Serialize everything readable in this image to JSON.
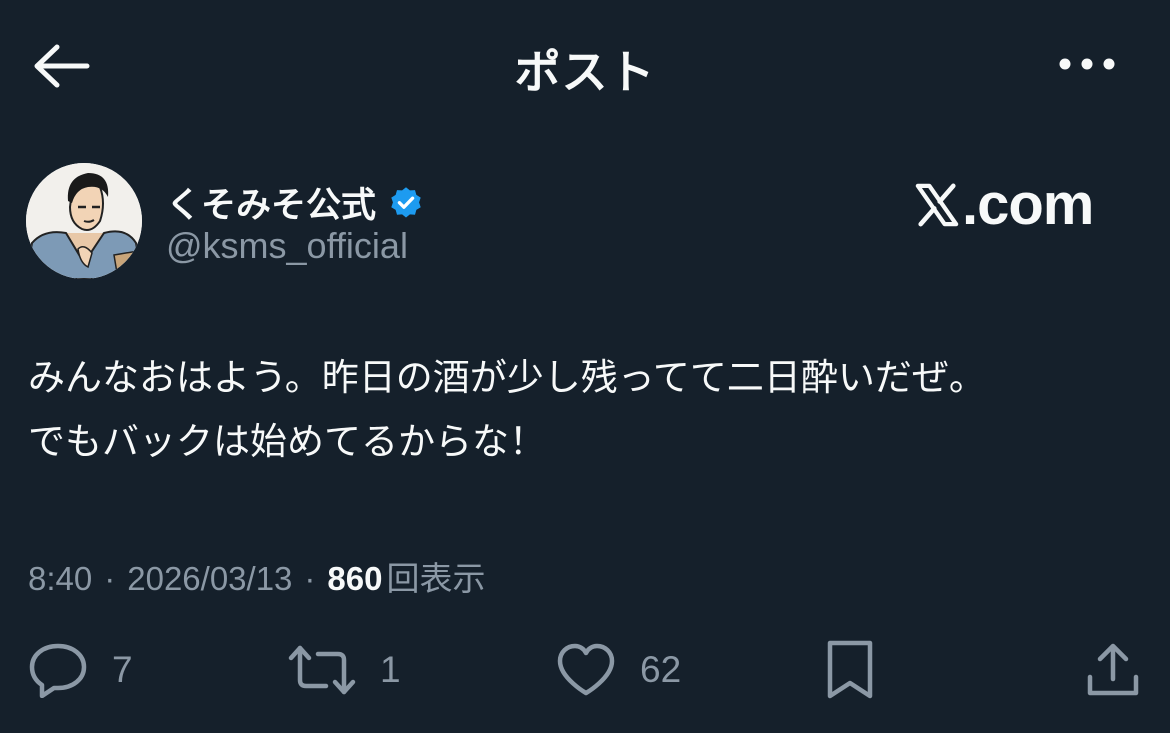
{
  "header": {
    "title": "ポスト",
    "back_icon": "arrow-left-icon",
    "more_icon": "more-dots-icon"
  },
  "author": {
    "display_name": "くそみそ公式",
    "handle": "@ksms_official",
    "verified_icon": "verified-badge-icon",
    "verified_color": "#1d9bf0"
  },
  "watermark": {
    "text": ".com"
  },
  "tweet": {
    "lines": [
      "みんなおはよう。昨日の酒が少し残ってて二日酔いだぜ。",
      "でもバックは始めてるからな！"
    ]
  },
  "meta": {
    "time": "8:40",
    "separator": "·",
    "date": "2026/03/13",
    "views": "860",
    "views_label": "回表示"
  },
  "actions": {
    "reply_count": "7",
    "retweet_count": "1",
    "like_count": "62"
  },
  "colors": {
    "background": "#15202b",
    "text": "#f7f9f9",
    "secondary": "#8b98a5",
    "accent": "#1d9bf0"
  }
}
